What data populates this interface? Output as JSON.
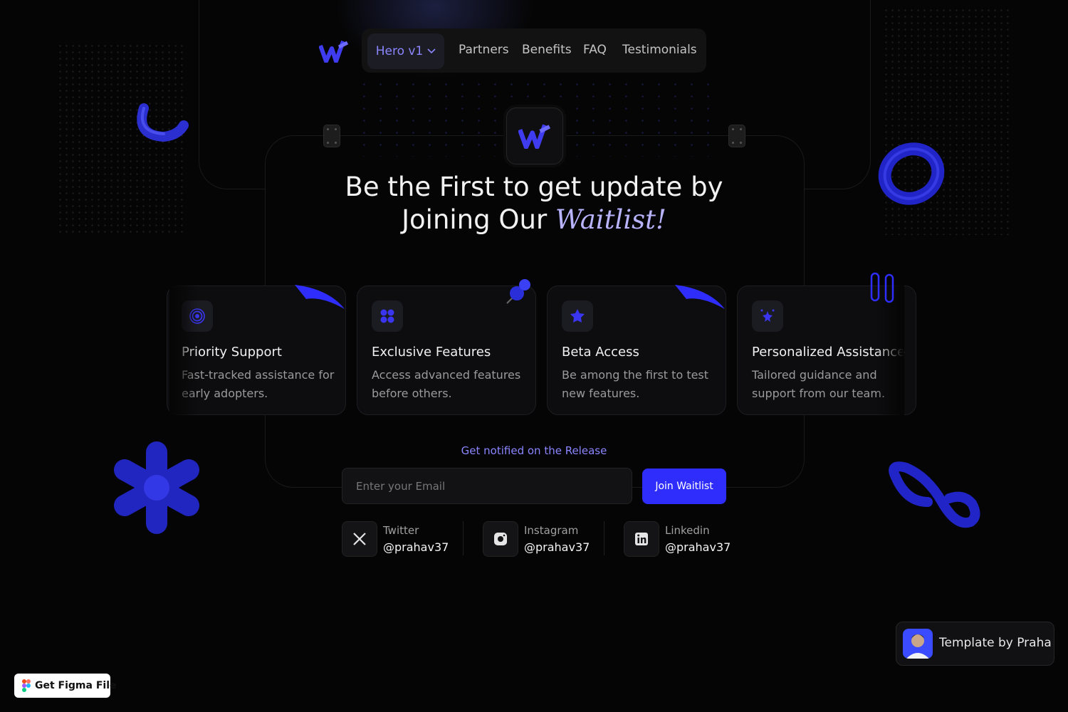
{
  "nav": {
    "active": "Hero v1",
    "links": [
      "Partners",
      "Benefits",
      "FAQ",
      "Testimonials"
    ]
  },
  "hero": {
    "line1": "Be the First to get update by",
    "line2_prefix": "Joining Our",
    "line2_accent": "Waitlist!"
  },
  "cards": [
    {
      "icon": "broadcast-icon",
      "title": "Priority Support",
      "desc": "Fast-tracked assistance for early adopters."
    },
    {
      "icon": "grid-icon",
      "title": "Exclusive Features",
      "desc": "Access advanced features before others."
    },
    {
      "icon": "star-badge-icon",
      "title": "Beta Access",
      "desc": "Be among the first to test new features."
    },
    {
      "icon": "sparkle-icon",
      "title": "Personalized Assistance",
      "desc": "Tailored guidance and support from our team."
    }
  ],
  "waitlist": {
    "notify": "Get notified on the Release",
    "placeholder": "Enter your Email",
    "button": "Join Waitlist"
  },
  "socials": [
    {
      "label": "Twitter",
      "handle": "@prahav37",
      "icon": "x-icon"
    },
    {
      "label": "Instagram",
      "handle": "@prahav37",
      "icon": "instagram-icon"
    },
    {
      "label": "Linkedin",
      "handle": "@prahav37",
      "icon": "linkedin-icon"
    }
  ],
  "template_badge": "Template by Praha",
  "figma_button": "Get Figma File",
  "colors": {
    "accent": "#2f2dfb",
    "accent_text": "#8b86ff",
    "background": "#050505"
  }
}
